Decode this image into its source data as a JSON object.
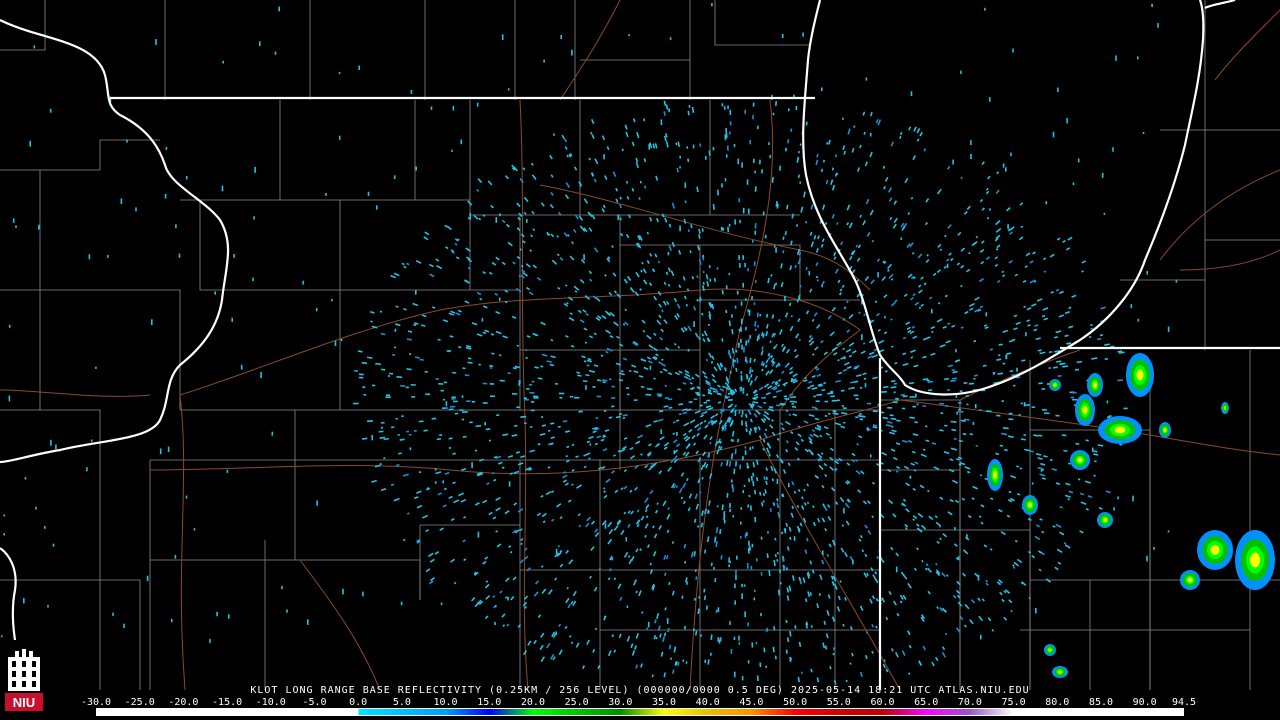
{
  "product": {
    "caption": "KLOT LONG RANGE BASE REFLECTIVITY (0.25KM / 256 LEVEL) (000000/0000 0.5 DEG) 2025-05-14 18:21 UTC  ATLAS.NIU.EDU",
    "logo_text": "NIU"
  },
  "colorbar": {
    "ticks": [
      "-30.0",
      "-25.0",
      "-20.0",
      "-15.0",
      "-10.0",
      "-5.0",
      "0.0",
      "5.0",
      "10.0",
      "15.0",
      "20.0",
      "25.0",
      "30.0",
      "35.0",
      "40.0",
      "45.0",
      "50.0",
      "55.0",
      "60.0",
      "65.0",
      "70.0",
      "75.0",
      "80.0",
      "85.0",
      "90.0",
      "94.5"
    ],
    "stops": [
      {
        "dbz": -30,
        "color": "#ffffff"
      },
      {
        "dbz": 0,
        "color": "#ffffff"
      },
      {
        "dbz": 0,
        "color": "#00e5ff"
      },
      {
        "dbz": 10,
        "color": "#009dff"
      },
      {
        "dbz": 15,
        "color": "#0000ff"
      },
      {
        "dbz": 20,
        "color": "#00ff00"
      },
      {
        "dbz": 30,
        "color": "#008f00"
      },
      {
        "dbz": 35,
        "color": "#ffff00"
      },
      {
        "dbz": 40,
        "color": "#e7c000"
      },
      {
        "dbz": 45,
        "color": "#ff9000"
      },
      {
        "dbz": 50,
        "color": "#ff0000"
      },
      {
        "dbz": 55,
        "color": "#d60000"
      },
      {
        "dbz": 60,
        "color": "#c00000"
      },
      {
        "dbz": 65,
        "color": "#ff00ff"
      },
      {
        "dbz": 70,
        "color": "#9955c9"
      },
      {
        "dbz": 75,
        "color": "#ffffff"
      },
      {
        "dbz": 94.5,
        "color": "#ffffff"
      }
    ]
  },
  "colors": {
    "state_border": "#ffffff",
    "county_border": "#8a8a8a",
    "highway": "#8b4a2b",
    "radar_clutter": "#22c3e6",
    "radar_clutter_dark": "#1a8fd6"
  }
}
